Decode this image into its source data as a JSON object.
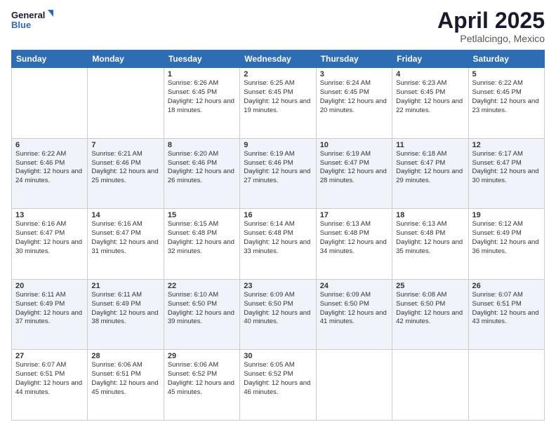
{
  "logo": {
    "line1": "General",
    "line2": "Blue"
  },
  "title": "April 2025",
  "subtitle": "Petlalcingo, Mexico",
  "days_of_week": [
    "Sunday",
    "Monday",
    "Tuesday",
    "Wednesday",
    "Thursday",
    "Friday",
    "Saturday"
  ],
  "weeks": [
    [
      {
        "day": "",
        "sunrise": "",
        "sunset": "",
        "daylight": ""
      },
      {
        "day": "",
        "sunrise": "",
        "sunset": "",
        "daylight": ""
      },
      {
        "day": "1",
        "sunrise": "Sunrise: 6:26 AM",
        "sunset": "Sunset: 6:45 PM",
        "daylight": "Daylight: 12 hours and 18 minutes."
      },
      {
        "day": "2",
        "sunrise": "Sunrise: 6:25 AM",
        "sunset": "Sunset: 6:45 PM",
        "daylight": "Daylight: 12 hours and 19 minutes."
      },
      {
        "day": "3",
        "sunrise": "Sunrise: 6:24 AM",
        "sunset": "Sunset: 6:45 PM",
        "daylight": "Daylight: 12 hours and 20 minutes."
      },
      {
        "day": "4",
        "sunrise": "Sunrise: 6:23 AM",
        "sunset": "Sunset: 6:45 PM",
        "daylight": "Daylight: 12 hours and 22 minutes."
      },
      {
        "day": "5",
        "sunrise": "Sunrise: 6:22 AM",
        "sunset": "Sunset: 6:45 PM",
        "daylight": "Daylight: 12 hours and 23 minutes."
      }
    ],
    [
      {
        "day": "6",
        "sunrise": "Sunrise: 6:22 AM",
        "sunset": "Sunset: 6:46 PM",
        "daylight": "Daylight: 12 hours and 24 minutes."
      },
      {
        "day": "7",
        "sunrise": "Sunrise: 6:21 AM",
        "sunset": "Sunset: 6:46 PM",
        "daylight": "Daylight: 12 hours and 25 minutes."
      },
      {
        "day": "8",
        "sunrise": "Sunrise: 6:20 AM",
        "sunset": "Sunset: 6:46 PM",
        "daylight": "Daylight: 12 hours and 26 minutes."
      },
      {
        "day": "9",
        "sunrise": "Sunrise: 6:19 AM",
        "sunset": "Sunset: 6:46 PM",
        "daylight": "Daylight: 12 hours and 27 minutes."
      },
      {
        "day": "10",
        "sunrise": "Sunrise: 6:19 AM",
        "sunset": "Sunset: 6:47 PM",
        "daylight": "Daylight: 12 hours and 28 minutes."
      },
      {
        "day": "11",
        "sunrise": "Sunrise: 6:18 AM",
        "sunset": "Sunset: 6:47 PM",
        "daylight": "Daylight: 12 hours and 29 minutes."
      },
      {
        "day": "12",
        "sunrise": "Sunrise: 6:17 AM",
        "sunset": "Sunset: 6:47 PM",
        "daylight": "Daylight: 12 hours and 30 minutes."
      }
    ],
    [
      {
        "day": "13",
        "sunrise": "Sunrise: 6:16 AM",
        "sunset": "Sunset: 6:47 PM",
        "daylight": "Daylight: 12 hours and 30 minutes."
      },
      {
        "day": "14",
        "sunrise": "Sunrise: 6:16 AM",
        "sunset": "Sunset: 6:47 PM",
        "daylight": "Daylight: 12 hours and 31 minutes."
      },
      {
        "day": "15",
        "sunrise": "Sunrise: 6:15 AM",
        "sunset": "Sunset: 6:48 PM",
        "daylight": "Daylight: 12 hours and 32 minutes."
      },
      {
        "day": "16",
        "sunrise": "Sunrise: 6:14 AM",
        "sunset": "Sunset: 6:48 PM",
        "daylight": "Daylight: 12 hours and 33 minutes."
      },
      {
        "day": "17",
        "sunrise": "Sunrise: 6:13 AM",
        "sunset": "Sunset: 6:48 PM",
        "daylight": "Daylight: 12 hours and 34 minutes."
      },
      {
        "day": "18",
        "sunrise": "Sunrise: 6:13 AM",
        "sunset": "Sunset: 6:48 PM",
        "daylight": "Daylight: 12 hours and 35 minutes."
      },
      {
        "day": "19",
        "sunrise": "Sunrise: 6:12 AM",
        "sunset": "Sunset: 6:49 PM",
        "daylight": "Daylight: 12 hours and 36 minutes."
      }
    ],
    [
      {
        "day": "20",
        "sunrise": "Sunrise: 6:11 AM",
        "sunset": "Sunset: 6:49 PM",
        "daylight": "Daylight: 12 hours and 37 minutes."
      },
      {
        "day": "21",
        "sunrise": "Sunrise: 6:11 AM",
        "sunset": "Sunset: 6:49 PM",
        "daylight": "Daylight: 12 hours and 38 minutes."
      },
      {
        "day": "22",
        "sunrise": "Sunrise: 6:10 AM",
        "sunset": "Sunset: 6:50 PM",
        "daylight": "Daylight: 12 hours and 39 minutes."
      },
      {
        "day": "23",
        "sunrise": "Sunrise: 6:09 AM",
        "sunset": "Sunset: 6:50 PM",
        "daylight": "Daylight: 12 hours and 40 minutes."
      },
      {
        "day": "24",
        "sunrise": "Sunrise: 6:09 AM",
        "sunset": "Sunset: 6:50 PM",
        "daylight": "Daylight: 12 hours and 41 minutes."
      },
      {
        "day": "25",
        "sunrise": "Sunrise: 6:08 AM",
        "sunset": "Sunset: 6:50 PM",
        "daylight": "Daylight: 12 hours and 42 minutes."
      },
      {
        "day": "26",
        "sunrise": "Sunrise: 6:07 AM",
        "sunset": "Sunset: 6:51 PM",
        "daylight": "Daylight: 12 hours and 43 minutes."
      }
    ],
    [
      {
        "day": "27",
        "sunrise": "Sunrise: 6:07 AM",
        "sunset": "Sunset: 6:51 PM",
        "daylight": "Daylight: 12 hours and 44 minutes."
      },
      {
        "day": "28",
        "sunrise": "Sunrise: 6:06 AM",
        "sunset": "Sunset: 6:51 PM",
        "daylight": "Daylight: 12 hours and 45 minutes."
      },
      {
        "day": "29",
        "sunrise": "Sunrise: 6:06 AM",
        "sunset": "Sunset: 6:52 PM",
        "daylight": "Daylight: 12 hours and 45 minutes."
      },
      {
        "day": "30",
        "sunrise": "Sunrise: 6:05 AM",
        "sunset": "Sunset: 6:52 PM",
        "daylight": "Daylight: 12 hours and 46 minutes."
      },
      {
        "day": "",
        "sunrise": "",
        "sunset": "",
        "daylight": ""
      },
      {
        "day": "",
        "sunrise": "",
        "sunset": "",
        "daylight": ""
      },
      {
        "day": "",
        "sunrise": "",
        "sunset": "",
        "daylight": ""
      }
    ]
  ]
}
